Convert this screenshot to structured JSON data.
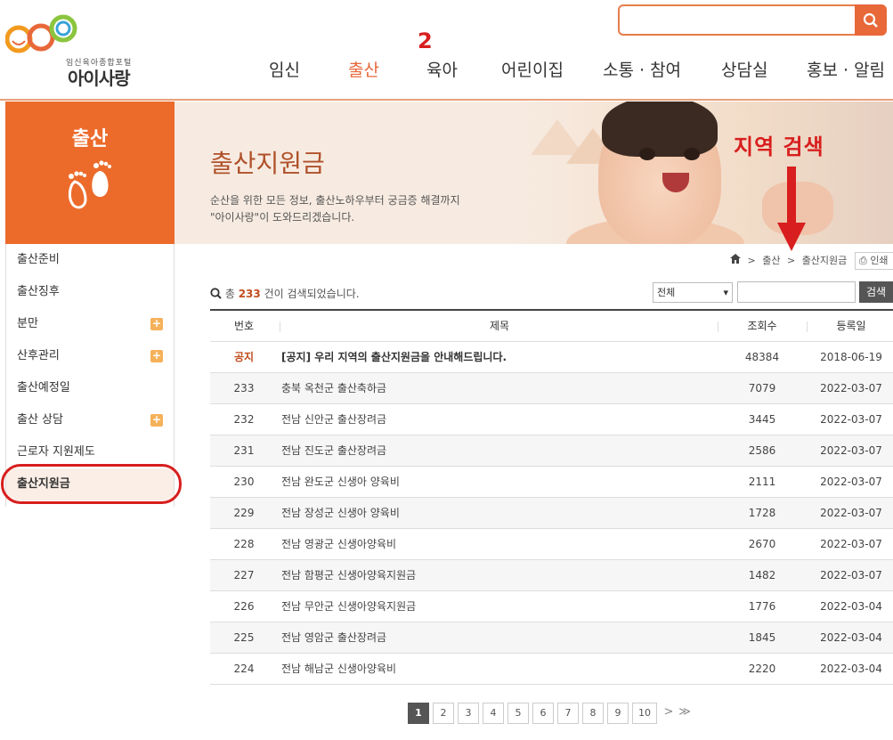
{
  "logo": {
    "sub": "임신육아종합포털",
    "main": "아이사랑"
  },
  "gnb": [
    {
      "label": "임신",
      "active": false
    },
    {
      "label": "출산",
      "active": true
    },
    {
      "label": "육아",
      "active": false
    },
    {
      "label": "어린이집",
      "active": false
    },
    {
      "label": "소통 · 참여",
      "active": false
    },
    {
      "label": "상담실",
      "active": false
    },
    {
      "label": "홍보 · 알림",
      "active": false
    }
  ],
  "annotations": {
    "number": "2",
    "region_search": "지역 검색",
    "color": "#d81e1e"
  },
  "sidebar": {
    "title": "출산",
    "items": [
      {
        "label": "출산준비",
        "has_sub": false
      },
      {
        "label": "출산징후",
        "has_sub": false
      },
      {
        "label": "분만",
        "has_sub": true
      },
      {
        "label": "산후관리",
        "has_sub": true
      },
      {
        "label": "출산예정일",
        "has_sub": false
      },
      {
        "label": "출산 상담",
        "has_sub": true
      },
      {
        "label": "근로자 지원제도",
        "has_sub": false
      },
      {
        "label": "출산지원금",
        "has_sub": false,
        "active": true
      }
    ],
    "plus": "+"
  },
  "banner": {
    "title": "출산지원금",
    "desc_line1": "순산을 위한 모든 정보, 출산노하우부터 궁금증 해결까지",
    "desc_line2": "\"아이사랑\"이 도와드리겠습니다."
  },
  "breadcrumb": {
    "sep": ">",
    "level1": "출산",
    "level2": "출산지원금",
    "print": "인쇄"
  },
  "search": {
    "count_prefix": "총",
    "count": "233",
    "count_suffix": "건이 검색되었습니다.",
    "filter": "전체",
    "button": "검색"
  },
  "table": {
    "headers": {
      "no": "번호",
      "title": "제목",
      "views": "조회수",
      "date": "등록일"
    },
    "notice": {
      "no": "공지",
      "title": "[공지] 우리 지역의 출산지원금을 안내해드립니다.",
      "views": "48384",
      "date": "2018-06-19"
    },
    "rows": [
      {
        "no": "233",
        "title": "충북 옥천군 출산축하금",
        "views": "7079",
        "date": "2022-03-07"
      },
      {
        "no": "232",
        "title": "전남 신안군 출산장려금",
        "views": "3445",
        "date": "2022-03-07"
      },
      {
        "no": "231",
        "title": "전남 진도군 출산장려금",
        "views": "2586",
        "date": "2022-03-07"
      },
      {
        "no": "230",
        "title": "전남 완도군 신생아 양육비",
        "views": "2111",
        "date": "2022-03-07"
      },
      {
        "no": "229",
        "title": "전남 장성군 신생아 양육비",
        "views": "1728",
        "date": "2022-03-07"
      },
      {
        "no": "228",
        "title": "전남 영광군 신생아양육비",
        "views": "2670",
        "date": "2022-03-07"
      },
      {
        "no": "227",
        "title": "전남 함평군 신생아양육지원금",
        "views": "1482",
        "date": "2022-03-07"
      },
      {
        "no": "226",
        "title": "전남 무안군 신생아양육지원금",
        "views": "1776",
        "date": "2022-03-04"
      },
      {
        "no": "225",
        "title": "전남 영암군 출산장려금",
        "views": "1845",
        "date": "2022-03-04"
      },
      {
        "no": "224",
        "title": "전남 해남군 신생아양육비",
        "views": "2220",
        "date": "2022-03-04"
      }
    ]
  },
  "pagination": {
    "pages": [
      "1",
      "2",
      "3",
      "4",
      "5",
      "6",
      "7",
      "8",
      "9",
      "10"
    ],
    "current": "1",
    "next": ">",
    "last": "≫"
  },
  "colors": {
    "brand": "#ec6b2b",
    "accent": "#e8683a",
    "notice": "#c24d1e"
  }
}
